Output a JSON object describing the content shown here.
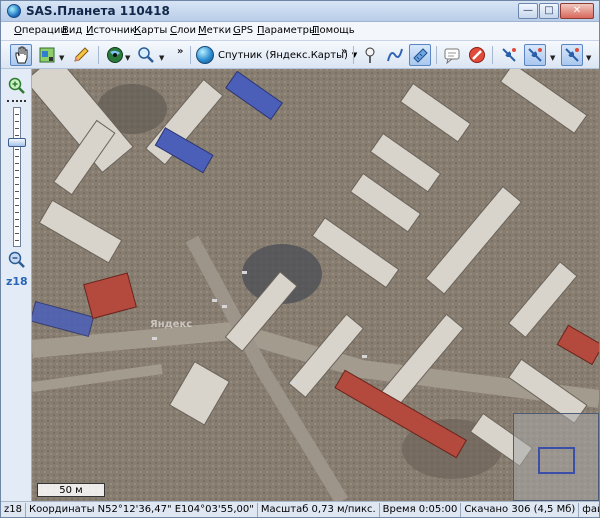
{
  "window": {
    "title": "SAS.Планета 110418"
  },
  "menu": {
    "items": [
      {
        "label": "Операции",
        "underline": "О"
      },
      {
        "label": "Вид",
        "underline": "В"
      },
      {
        "label": "Источник",
        "underline": "И"
      },
      {
        "label": "Карты",
        "underline": "К"
      },
      {
        "label": "Слои",
        "underline": "С"
      },
      {
        "label": "Метки",
        "underline": "М"
      },
      {
        "label": "GPS",
        "underline": "G"
      },
      {
        "label": "Параметры",
        "underline": "П"
      },
      {
        "label": "Помощь",
        "underline": "П"
      }
    ]
  },
  "toolbar": {
    "map_source": "Спутник (Яндекс.Карты)",
    "icons": [
      "hand-pan-icon",
      "layer-select-icon",
      "pencil-icon",
      "globe-icon",
      "magnifier-icon",
      "map-pin-icon",
      "route-path-icon",
      "ruler-icon",
      "balloon-icon",
      "stop-icon",
      "gps-satellite-icon",
      "gps-track-icon",
      "gps-center-icon"
    ]
  },
  "zoom": {
    "level": "z18"
  },
  "map": {
    "scale": "50 м",
    "watermark": "Яндекс"
  },
  "status": {
    "zoom": "z18",
    "coords": "Координаты N52°12'36,47\" E104°03'55,00\"",
    "scale": "Масштаб 0,73 м/пикс.",
    "time": "Время 0:05:00",
    "downloaded": "Скачано 306 (4,5 Мб)",
    "file": "файл"
  },
  "colors": {
    "accent": "#2a66b8",
    "titlebar": "#b9cde8"
  }
}
